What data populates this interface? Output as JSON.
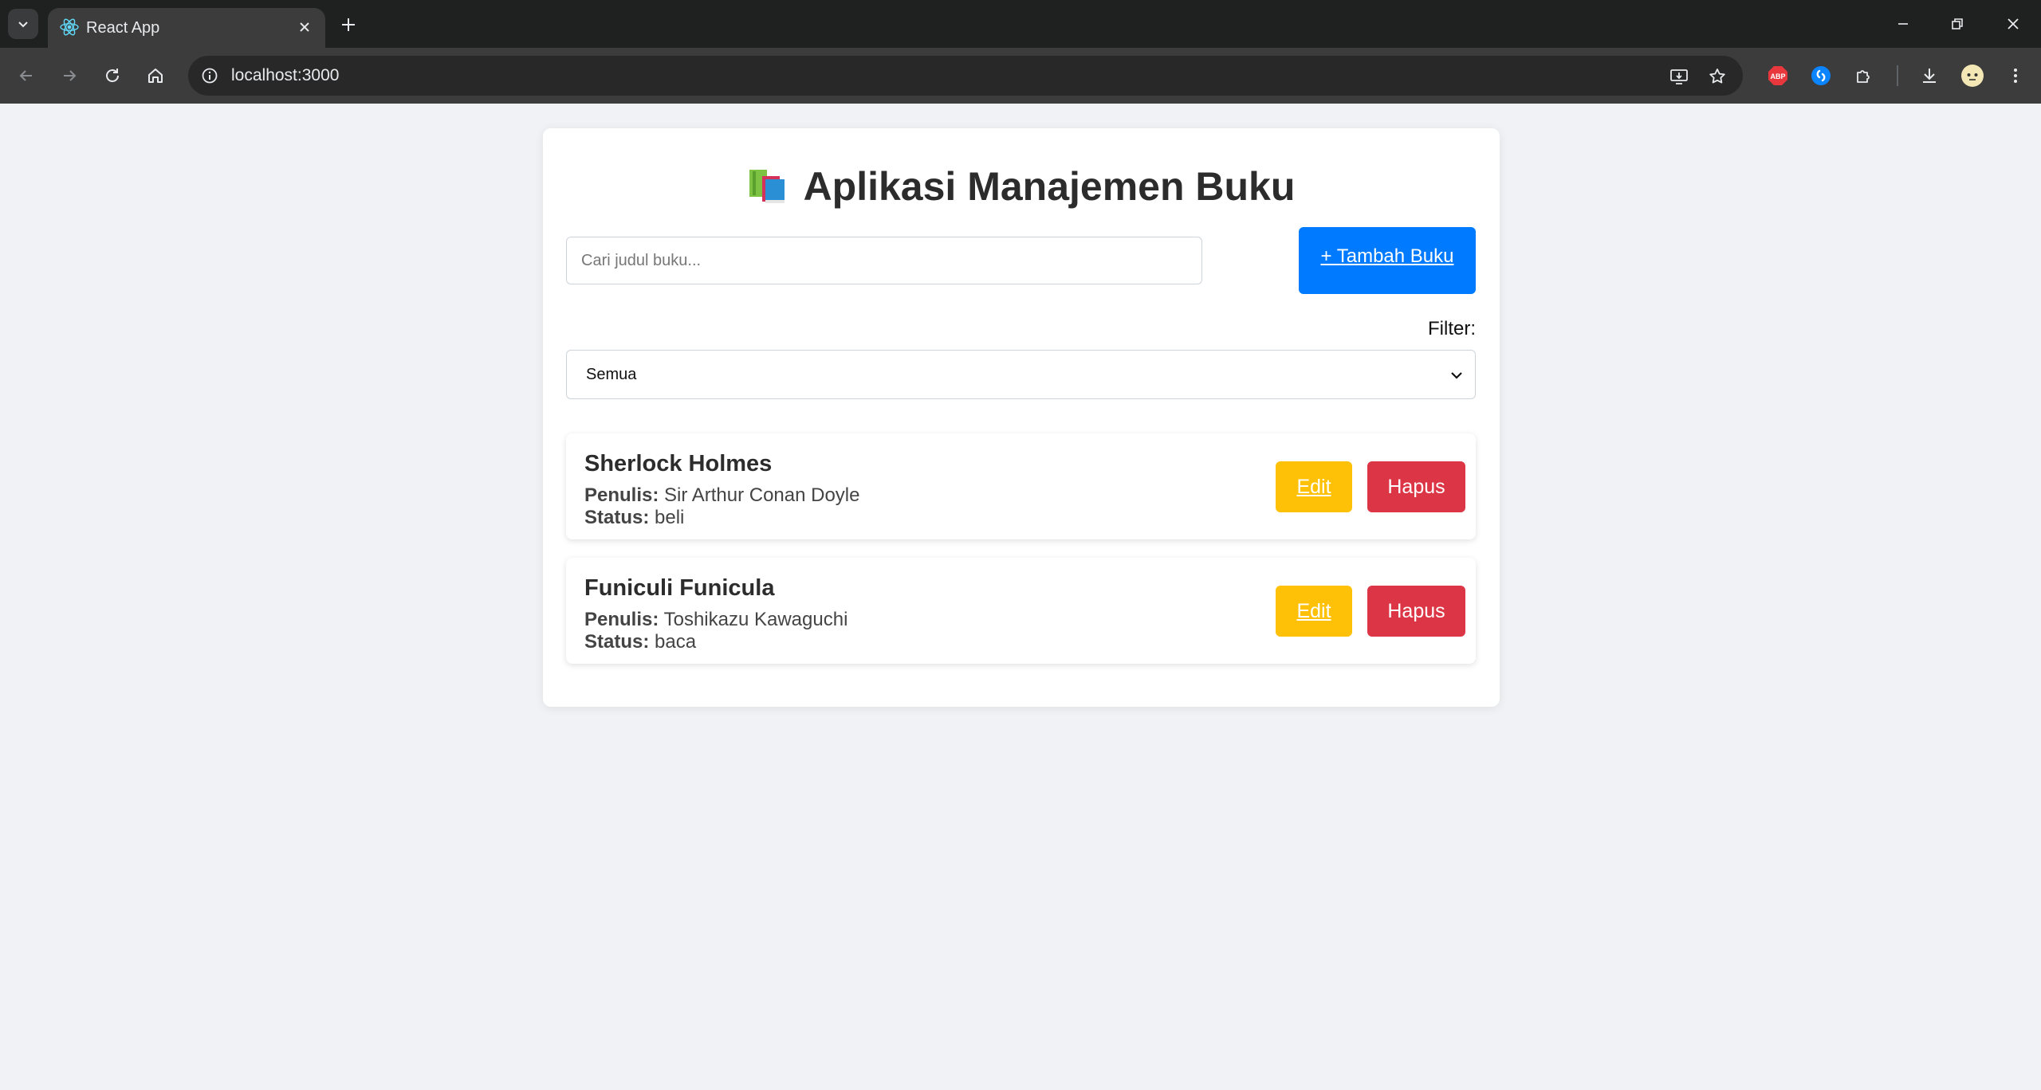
{
  "browser": {
    "tab_title": "React App",
    "url": "localhost:3000"
  },
  "app": {
    "title": "Aplikasi Manajemen Buku",
    "search_placeholder": "Cari judul buku...",
    "add_button": "+ Tambah Buku",
    "filter_label": "Filter:",
    "filter_value": "Semua",
    "author_label": "Penulis:",
    "status_label": "Status:",
    "edit_label": "Edit",
    "delete_label": "Hapus",
    "books": [
      {
        "title": "Sherlock Holmes",
        "author": "Sir Arthur Conan Doyle",
        "status": "beli"
      },
      {
        "title": "Funiculi Funicula",
        "author": "Toshikazu Kawaguchi",
        "status": "baca"
      }
    ]
  },
  "colors": {
    "primary": "#007bff",
    "edit": "#ffc107",
    "delete": "#dc3545",
    "page_bg": "#f0f2f5"
  }
}
